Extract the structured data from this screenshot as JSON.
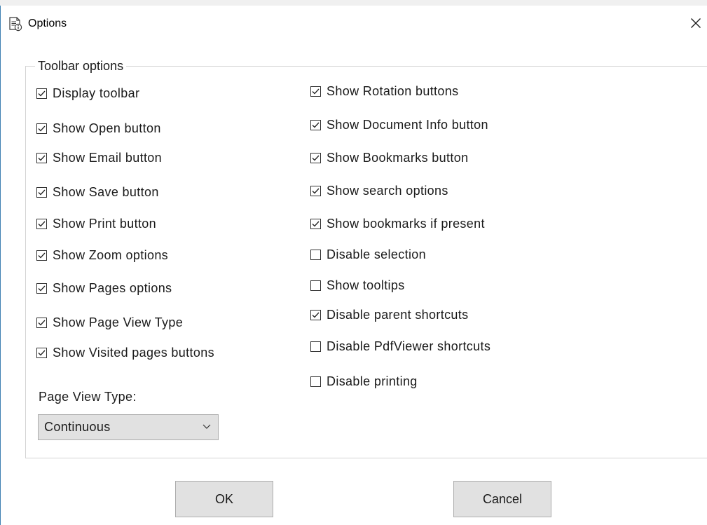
{
  "window": {
    "title": "Options",
    "icon": "document-info-icon",
    "close_glyph": "✕"
  },
  "toolbar_options": {
    "legend": "Toolbar options",
    "left_column": [
      {
        "label": "Display toolbar",
        "checked": true
      },
      {
        "label": "Show Open button",
        "checked": true
      },
      {
        "label": "Show Email button",
        "checked": true
      },
      {
        "label": "Show Save button",
        "checked": true
      },
      {
        "label": "Show Print button",
        "checked": true
      },
      {
        "label": "Show Zoom options",
        "checked": true
      },
      {
        "label": "Show Pages options",
        "checked": true
      },
      {
        "label": "Show Page View Type",
        "checked": true
      },
      {
        "label": "Show Visited pages buttons",
        "checked": true
      }
    ],
    "right_column": [
      {
        "label": "Show Rotation buttons",
        "checked": true
      },
      {
        "label": "Show Document Info button",
        "checked": true
      },
      {
        "label": "Show Bookmarks button",
        "checked": true
      },
      {
        "label": "Show search options",
        "checked": true
      },
      {
        "label": "Show bookmarks if present",
        "checked": true
      },
      {
        "label": "Disable selection",
        "checked": false
      },
      {
        "label": "Show tooltips",
        "checked": false
      },
      {
        "label": "Disable parent shortcuts",
        "checked": true
      },
      {
        "label": "Disable PdfViewer shortcuts",
        "checked": false
      },
      {
        "label": "Disable printing",
        "checked": false
      }
    ],
    "page_view_type": {
      "label": "Page View Type:",
      "selected": "Continuous"
    }
  },
  "buttons": {
    "ok_label": "OK",
    "cancel_label": "Cancel"
  }
}
